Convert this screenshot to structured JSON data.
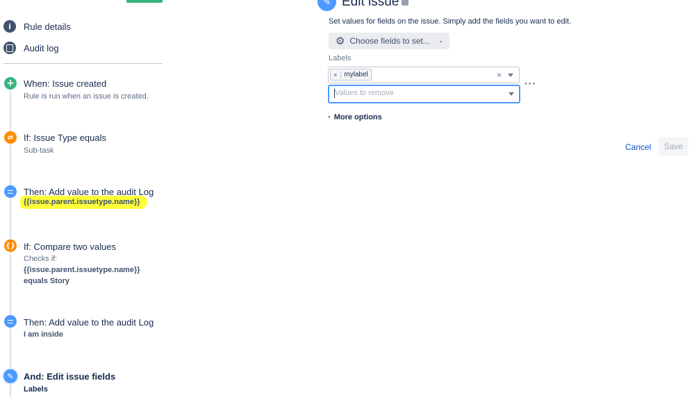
{
  "nav": {
    "rule_details": "Rule details",
    "audit_log": "Audit log"
  },
  "steps": [
    {
      "title": "When: Issue created",
      "sub": "Rule is run when an issue is created.",
      "icon": "plus-icon",
      "color": "#36b37e"
    },
    {
      "title": "If: Issue Type equals",
      "sub": "Sub-task",
      "icon": "shuffle-icon",
      "color": "#ff8b00"
    },
    {
      "title": "Then: Add value to the audit Log",
      "sub": "{{issue.parent.issuetype.name}}",
      "icon": "list-icon",
      "color": "#4c9aff"
    },
    {
      "title": "If: Compare two values",
      "sub": "Checks if:",
      "sub2": "{{issue.parent.issuetype.name}}",
      "sub3": "equals Story",
      "icon": "braces-icon",
      "color": "#ff8b00"
    },
    {
      "title": "Then: Add value to the audit Log",
      "sub": "I am inside",
      "icon": "list-icon",
      "color": "#4c9aff"
    },
    {
      "title": "And: Edit issue fields",
      "sub": "Labels",
      "icon": "pencil-icon",
      "color": "#4c9aff"
    }
  ],
  "panel": {
    "title": "Edit issue",
    "description": "Set values for fields on the issue. Simply add the fields you want to edit.",
    "choose_fields": "Choose fields to set...",
    "labels_label": "Labels",
    "tag": "mylabel",
    "remove_placeholder": "Values to remove",
    "more_options": "More options",
    "cancel": "Cancel",
    "save": "Save"
  }
}
